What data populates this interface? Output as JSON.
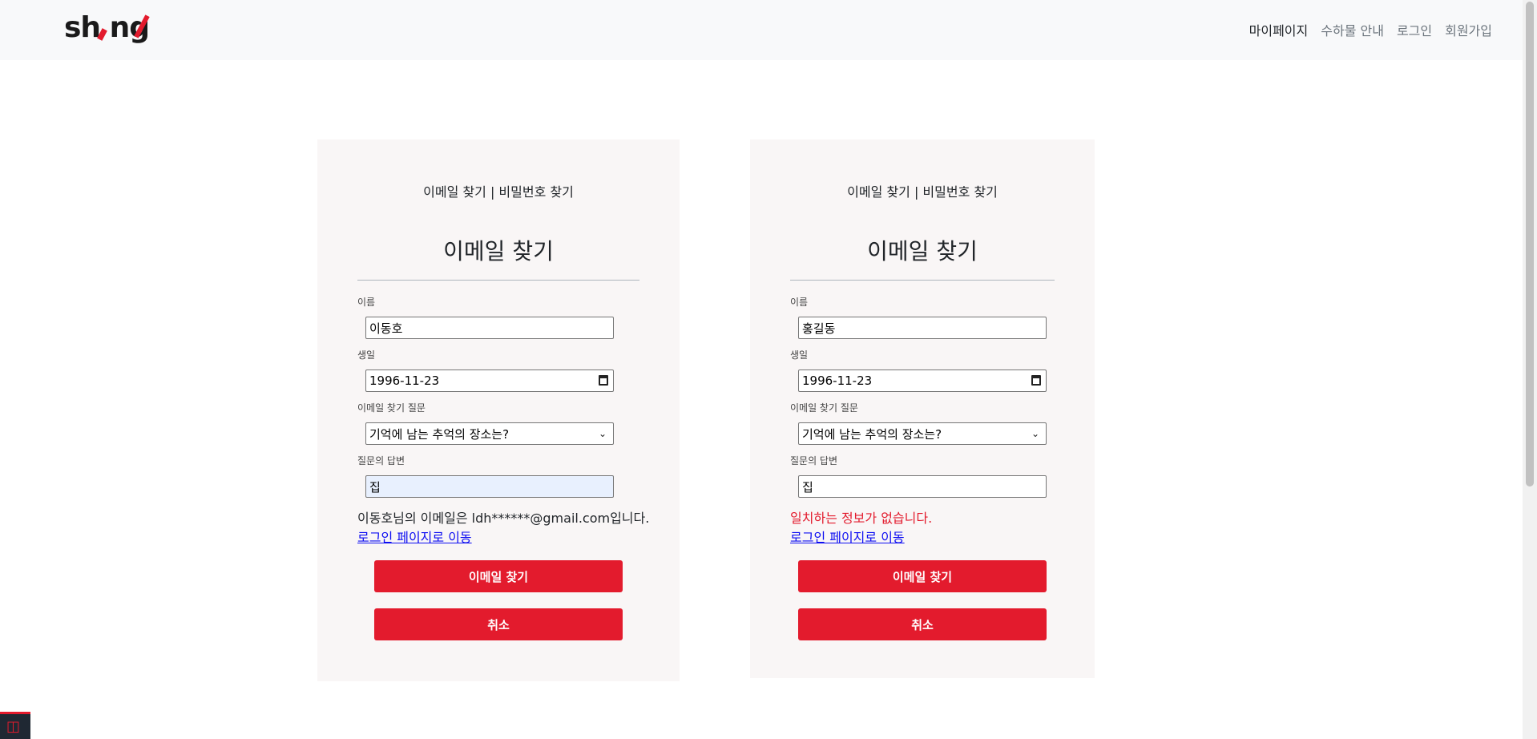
{
  "navbar": {
    "logo_text": "sh ng",
    "links": [
      "마이페이지",
      "수하물 안내",
      "로그인",
      "회원가입"
    ]
  },
  "cards": [
    {
      "switch_email": "이메일 찾기",
      "switch_sep": " | ",
      "switch_password": "비밀번호 찾기",
      "title": "이메일 찾기",
      "name_label": "이름",
      "name_value": "이동호",
      "birth_label": "생일",
      "birth_value": "1996-11-23",
      "question_label": "이메일 찾기 질문",
      "question_value": "기억에 남는 추억의 장소는?",
      "answer_label": "질문의 답변",
      "answer_value": "집",
      "result_message": "이동호님의 이메일은 ldh******@gmail.com입니다.",
      "login_link": "로그인 페이지로 이동",
      "find_button": "이메일 찾기",
      "cancel_button": "취소"
    },
    {
      "switch_email": "이메일 찾기",
      "switch_sep": " | ",
      "switch_password": "비밀번호 찾기",
      "title": "이메일 찾기",
      "name_label": "이름",
      "name_value": "홍길동",
      "birth_label": "생일",
      "birth_value": "1996-11-23",
      "question_label": "이메일 찾기 질문",
      "question_value": "기억에 남는 추억의 장소는?",
      "answer_label": "질문의 답변",
      "answer_value": "집",
      "result_message": "일치하는 정보가 없습니다.",
      "login_link": "로그인 페이지로 이동",
      "find_button": "이메일 찾기",
      "cancel_button": "취소"
    }
  ],
  "colors": {
    "brand_red": "#e31b2d",
    "navbar_bg": "#f8f9fa",
    "card_bg": "#f9f6f6",
    "link_blue": "#0d0df2"
  },
  "icons": {
    "calendar": "calendar-icon",
    "dropdown": "chevron-down-icon",
    "debugbar": "laravel-icon"
  }
}
